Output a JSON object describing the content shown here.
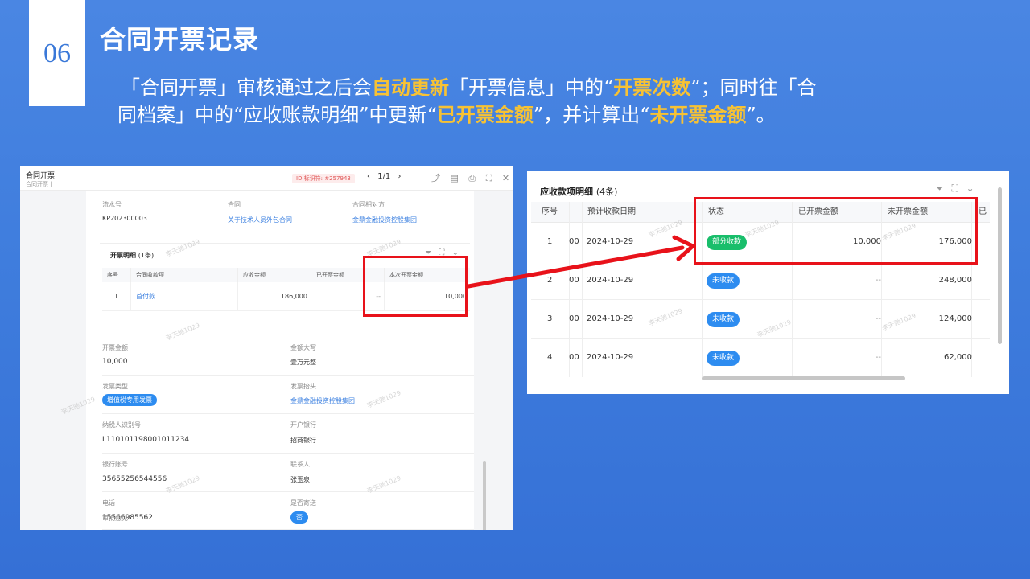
{
  "slide": {
    "number": "06",
    "title": "合同开票记录",
    "desc": {
      "p1": "「合同开票」审核通过之后会",
      "h1": "自动更新",
      "p2": "「开票信息」中的“",
      "h2": "开票次数",
      "p3": "”；同时往「合",
      "p4": "同档案」中的“应收账款明细”中更新“",
      "h3": "已开票金额",
      "p5": "”，并计算出“",
      "h4": "未开票金额",
      "p6": "”。"
    }
  },
  "left_panel": {
    "title": "合同开票",
    "subtitle": "合同开票 |",
    "id_label": "ID 标识符: #257943",
    "pager": {
      "prev": "‹",
      "text": "1/1",
      "next": "›"
    },
    "tools": [
      "⤴",
      "▤",
      "⎙",
      "⛶",
      "✕"
    ],
    "fields_top": [
      {
        "label": "流水号",
        "value": "KP202300003"
      },
      {
        "label": "合同",
        "value": "关于技术人员外包合同"
      },
      {
        "label": "合同相对方",
        "value": "金鼎金融投资控股集团"
      }
    ],
    "invoice_detail": {
      "title": "开票明细",
      "count": "(1条)",
      "tools": [
        "⏷",
        "⛶",
        "⌄"
      ],
      "headers": [
        "序号",
        "合同收款项",
        "应收金额",
        "已开票金额",
        "本次开票金额"
      ],
      "row": {
        "index": "1",
        "item": "首付款",
        "receivable": "186,000",
        "invoiced": "--",
        "current": "10,000"
      }
    },
    "fields": [
      {
        "label": "开票金额",
        "value": "10,000"
      },
      {
        "label": "金额大写",
        "value": "壹万元整"
      },
      {
        "label": "发票类型",
        "value": "增值税专用发票"
      },
      {
        "label": "发票抬头",
        "value": "金鼎金融投资控股集团"
      },
      {
        "label": "纳税人识别号",
        "value": "L110101198001011234"
      },
      {
        "label": "开户银行",
        "value": "招商银行"
      },
      {
        "label": "银行账号",
        "value": "35655256544556"
      },
      {
        "label": "联系人",
        "value": "张玉泉"
      },
      {
        "label": "电话",
        "value": "15566985562"
      },
      {
        "label": "是否寄送",
        "value": "否"
      },
      {
        "label": "审批意见",
        "value": ""
      }
    ],
    "watermark": "李天驰1029"
  },
  "right_panel": {
    "title": "应收款项明细",
    "count": "(4条)",
    "tools": [
      "⏷",
      "⛶",
      "⌄"
    ],
    "headers": [
      "序号",
      "预计收款日期",
      "状态",
      "已开票金额",
      "未开票金额",
      "已"
    ],
    "rows": [
      {
        "index": "1",
        "cut": "00",
        "date": "2024-10-29",
        "status": "部分收款",
        "invoiced": "10,000",
        "uninvoiced": "176,000"
      },
      {
        "index": "2",
        "cut": "00",
        "date": "2024-10-29",
        "status": "未收款",
        "invoiced": "--",
        "uninvoiced": "248,000"
      },
      {
        "index": "3",
        "cut": "00",
        "date": "2024-10-29",
        "status": "未收款",
        "invoiced": "--",
        "uninvoiced": "124,000"
      },
      {
        "index": "4",
        "cut": "00",
        "date": "2024-10-29",
        "status": "未收款",
        "invoiced": "--",
        "uninvoiced": "62,000"
      }
    ],
    "watermark": "李天驰1029"
  },
  "colors": {
    "background": "#3f7ddd",
    "highlight": "#f7c234",
    "annotation_red": "#e8121a",
    "status_partial": "#19be6b",
    "status_unpaid": "#2d8cf0",
    "link": "#3a7fe0"
  }
}
